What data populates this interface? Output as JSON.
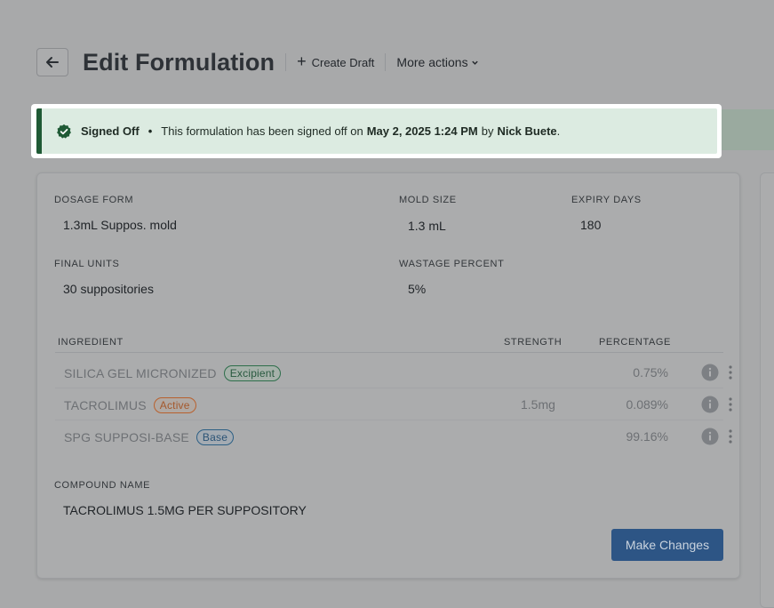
{
  "header": {
    "title": "Edit Formulation",
    "create_draft": "Create Draft",
    "more_actions": "More actions"
  },
  "banner": {
    "status": "Signed Off",
    "message_prefix": "This formulation has been signed off on",
    "date": "May 2, 2025 1:24 PM",
    "by": "by",
    "user": "Nick Buete",
    "suffix": "."
  },
  "fields": {
    "dosage_form": {
      "label": "DOSAGE FORM",
      "value": "1.3mL Suppos. mold"
    },
    "mold_size": {
      "label": "MOLD SIZE",
      "value": "1.3 mL"
    },
    "expiry_days": {
      "label": "EXPIRY DAYS",
      "value": "180"
    },
    "final_units": {
      "label": "FINAL UNITS",
      "value": "30 suppositories"
    },
    "wastage_percent": {
      "label": "WASTAGE PERCENT",
      "value": "5%"
    },
    "compound_name": {
      "label": "COMPOUND NAME",
      "value": "TACROLIMUS 1.5MG PER SUPPOSITORY"
    }
  },
  "table": {
    "headers": {
      "ingredient": "INGREDIENT",
      "strength": "STRENGTH",
      "percentage": "PERCENTAGE"
    },
    "rows": [
      {
        "name": "SILICA GEL MICRONIZED",
        "badge": "Excipient",
        "strength": "",
        "percentage": "0.75%"
      },
      {
        "name": "TACROLIMUS",
        "badge": "Active",
        "strength": "1.5mg",
        "percentage": "0.089%"
      },
      {
        "name": "SPG SUPPOSI-BASE",
        "badge": "Base",
        "strength": "",
        "percentage": "99.16%"
      }
    ]
  },
  "actions": {
    "make_changes": "Make Changes"
  },
  "colors": {
    "banner_bg": "#dcebe1",
    "banner_accent": "#1f5a35",
    "primary_button": "#2d5585",
    "excipient": "#2e6e4b",
    "active": "#b8612e",
    "base": "#2c5f84"
  }
}
